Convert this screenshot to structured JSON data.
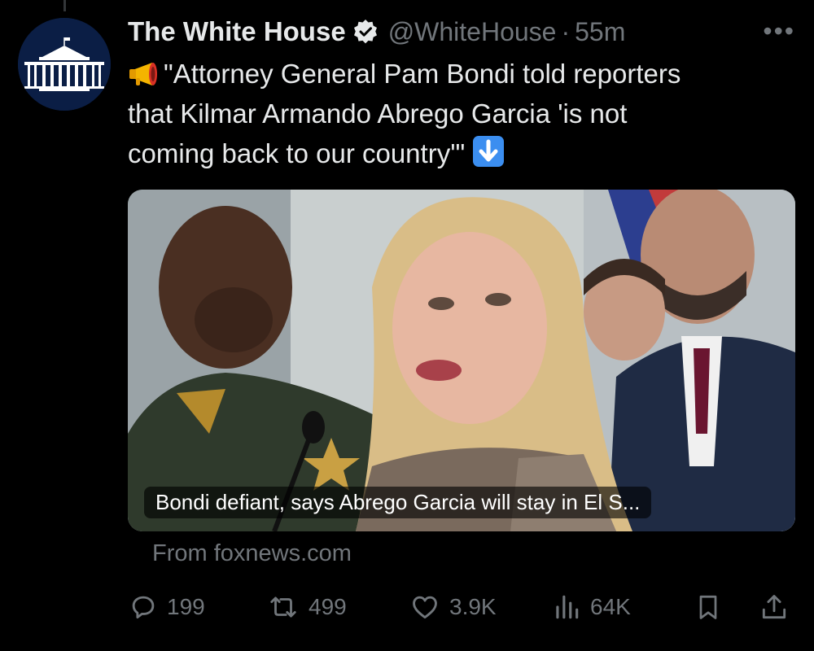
{
  "tweet": {
    "display_name": "The White House",
    "handle": "@WhiteHouse",
    "separator": "·",
    "timestamp": "55m",
    "more_label": "•••",
    "verified": true,
    "text_line_1": "\"Attorney General Pam Bondi told reporters",
    "text_line_2": "that Kilmar Armando Abrego Garcia 'is not",
    "text_line_3": "coming back to our country'\"",
    "lead_emoji": "megaphone-emoji",
    "trail_emoji": "down-arrow-emoji"
  },
  "media": {
    "caption": "Bondi defiant, says Abrego Garcia will stay in El S...",
    "source": "From foxnews.com"
  },
  "actions": {
    "replies": "199",
    "reposts": "499",
    "likes": "3.9K",
    "views": "64K"
  },
  "icons": {
    "reply": "reply-icon",
    "repost": "repost-icon",
    "like": "like-icon",
    "views": "views-icon",
    "bookmark": "bookmark-icon",
    "share": "share-icon"
  },
  "colors": {
    "background": "#000000",
    "text": "#e7e9ea",
    "secondary": "#71767b",
    "verified_blue": "#1d9bf0"
  }
}
